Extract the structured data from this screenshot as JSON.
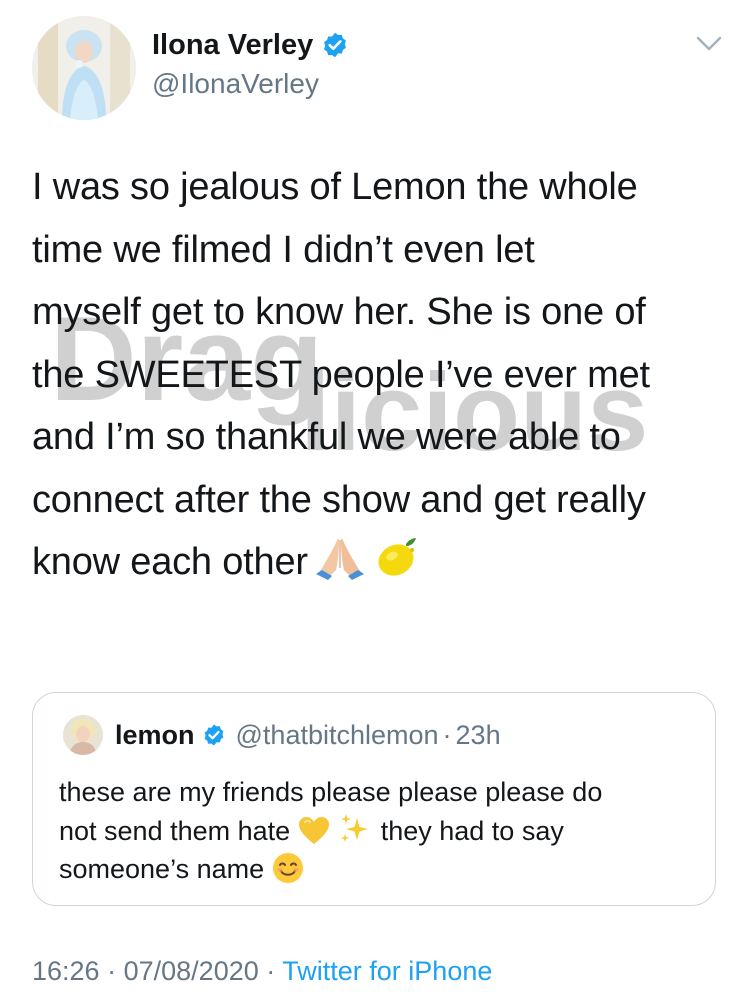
{
  "author": {
    "display_name": "Ilona Verley",
    "handle": "@IlonaVerley",
    "verified": true,
    "verified_icon": "verified-badge-icon"
  },
  "tweet": {
    "text_lines": [
      "I was so jealous of Lemon the whole",
      "time we filmed I didn’t even let",
      "myself get to know her. She is one of",
      "the SWEETEST people I’ve ever met",
      "and I’m so thankful we were able to",
      "connect after the show and get really",
      "know each other"
    ],
    "trailing_emojis": [
      "folded-hands-emoji",
      "lemon-emoji"
    ]
  },
  "watermark": {
    "text_top": "Drag",
    "text_bottom": "licious"
  },
  "quoted_tweet": {
    "display_name": "lemon",
    "handle": "@thatbitchlemon",
    "separator": "·",
    "time": "23h",
    "text_line1": "these are my friends please please please do",
    "text_line2a": "not send them hate",
    "text_line2b": "they had to say",
    "text_line3": "someone’s name",
    "emojis": [
      "yellow-heart-emoji",
      "sparkles-emoji",
      "smiling-face-emoji"
    ]
  },
  "footer": {
    "time": "16:26",
    "separator": "·",
    "date": "07/08/2020",
    "separator2": "·",
    "source": "Twitter for iPhone"
  },
  "colors": {
    "text": "#14171a",
    "secondary": "#657786",
    "link": "#1da1f2",
    "border": "#ccd6dd",
    "verified": "#1da1f2"
  }
}
